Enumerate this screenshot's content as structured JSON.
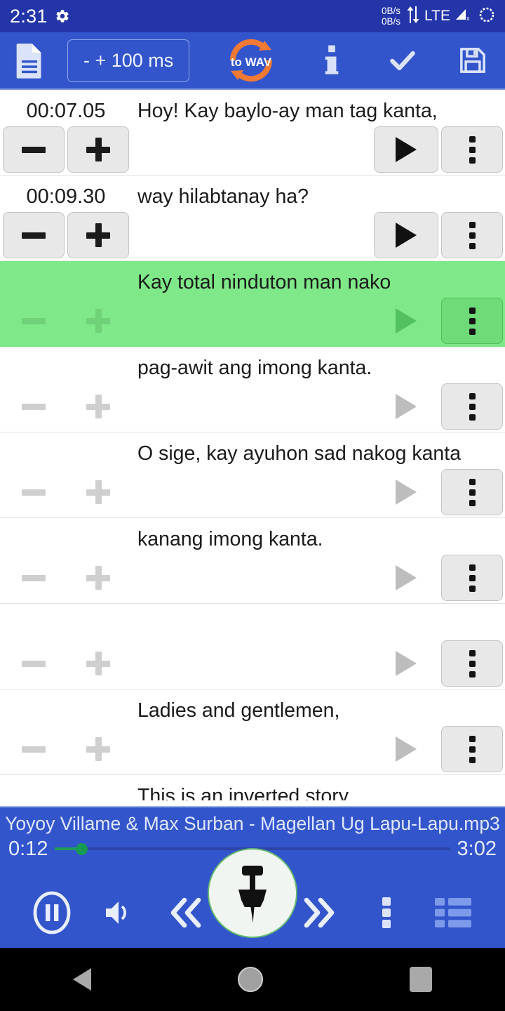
{
  "status_bar": {
    "clock": "2:31",
    "gear_icon": "gear-icon",
    "data_up": "0B/s",
    "data_down": "0B/s",
    "network": "LTE",
    "signal_icon": "signal-no-sim-icon",
    "sync_icon": "sync-spinner-icon"
  },
  "toolbar": {
    "doc_icon": "document-icon",
    "shift_label": "- + 100 ms",
    "wav_label_top": "to",
    "wav_label_main": "WAV",
    "info_icon": "info-icon",
    "check_icon": "check-icon",
    "save_icon": "save-floppy-icon",
    "accent": "#3355cc",
    "wav_accent": "#f07a33"
  },
  "list": {
    "rows": [
      {
        "time": "00:07.05",
        "text": "Hoy! Kay baylo-ay man tag kanta,",
        "selected": false,
        "active": true
      },
      {
        "time": "00:09.30",
        "text": "way hilabtanay ha?",
        "selected": false,
        "active": true
      },
      {
        "time": "",
        "text": "Kay total ninduton man nako",
        "selected": true,
        "active": false
      },
      {
        "time": "",
        "text": "pag-awit ang imong kanta.",
        "selected": false,
        "active": false
      },
      {
        "time": "",
        "text": "O sige, kay ayuhon sad nakog kanta",
        "selected": false,
        "active": false
      },
      {
        "time": "",
        "text": "kanang imong kanta.",
        "selected": false,
        "active": false
      },
      {
        "time": "",
        "text": "",
        "selected": false,
        "active": false
      },
      {
        "time": "",
        "text": "Ladies and gentlemen,",
        "selected": false,
        "active": false
      }
    ],
    "partial_row": {
      "text": "This is an inverted story"
    },
    "selected_color": "#7fe888",
    "minus_label": "minus-icon",
    "plus_label": "plus-icon",
    "play_label": "play-icon",
    "menu_label": "overflow-menu-icon"
  },
  "player": {
    "title": "Yoyoy Villame & Max Surban - Magellan Ug Lapu-Lapu.mp3",
    "current_time": "0:12",
    "total_time": "3:02",
    "progress_percent": 6.6,
    "thumb_color": "#169c52"
  },
  "controls": [
    {
      "name": "pause-button",
      "icon": "pause-circle-icon"
    },
    {
      "name": "volume-button",
      "icon": "volume-icon"
    },
    {
      "name": "rewind-button",
      "icon": "double-chevron-left-icon"
    },
    {
      "name": "pin-button",
      "icon": "pushpin-icon"
    },
    {
      "name": "forward-button",
      "icon": "double-chevron-right-icon"
    },
    {
      "name": "more-button",
      "icon": "overflow-menu-icon"
    },
    {
      "name": "playlist-button",
      "icon": "list-icon"
    }
  ],
  "navbar": {
    "back": "back-triangle-icon",
    "home": "home-circle-icon",
    "recents": "recents-square-icon"
  }
}
